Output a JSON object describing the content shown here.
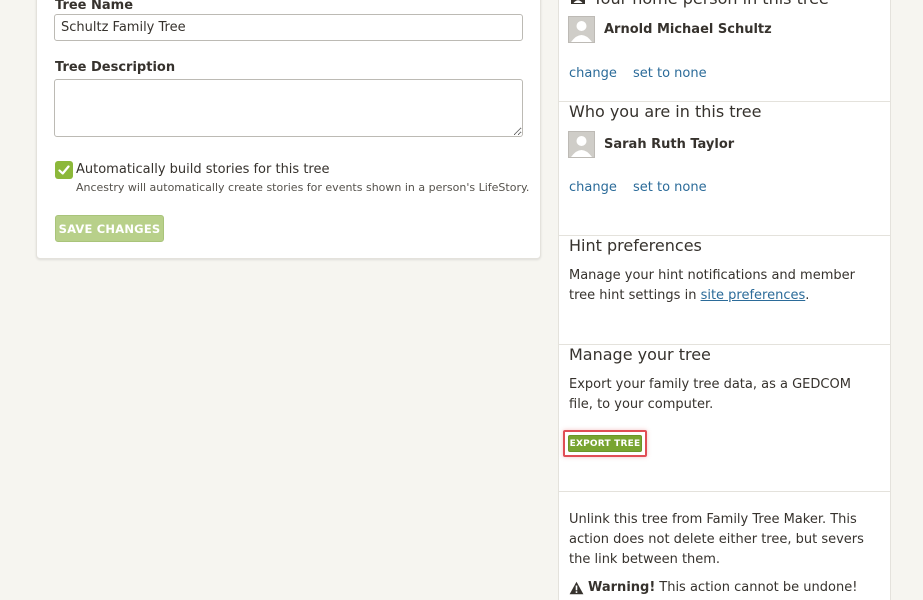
{
  "tree_settings": {
    "tree_name_label": "Tree Name",
    "tree_name_value": "Schultz Family Tree",
    "tree_description_label": "Tree Description",
    "tree_description_value": "",
    "auto_stories_checked": true,
    "auto_stories_label": "Automatically build stories for this tree",
    "auto_stories_help": "Ancestry will automatically create stories for events shown in a person's LifeStory.",
    "save_label": "SAVE CHANGES"
  },
  "sidebar": {
    "home_person": {
      "title": "Your home person in this tree",
      "name": "Arnold Michael Schultz",
      "change_label": "change",
      "set_none_label": "set to none"
    },
    "who_you_are": {
      "title": "Who you are in this tree",
      "name": "Sarah Ruth Taylor",
      "change_label": "change",
      "set_none_label": "set to none"
    },
    "hint_preferences": {
      "title": "Hint preferences",
      "text_before": "Manage your hint notifications and member tree hint settings in ",
      "link_label": "site preferences",
      "text_after": "."
    },
    "manage_tree": {
      "title": "Manage your tree",
      "text": "Export your family tree data, as a GEDCOM file, to your computer.",
      "export_label": "EXPORT TREE"
    },
    "unlink": {
      "text": "Unlink this tree from Family Tree Maker. This action does not delete either tree, but severs the link between them.",
      "warning_strong": "Warning!",
      "warning_text": "This action cannot be undone!"
    }
  },
  "colors": {
    "accent_green": "#78a431",
    "link_blue": "#2b6b99",
    "highlight_red": "#e04d55"
  }
}
